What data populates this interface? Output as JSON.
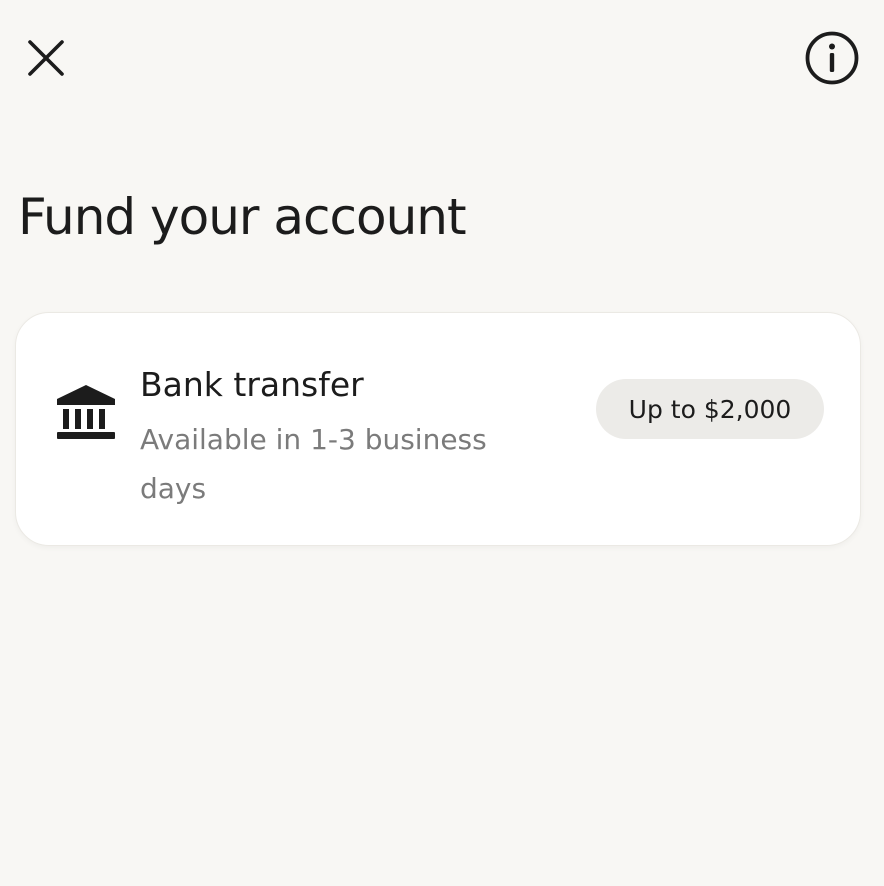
{
  "header": {
    "close_icon": "close-icon",
    "info_icon": "info-icon"
  },
  "page": {
    "title": "Fund your account"
  },
  "option": {
    "icon": "bank-icon",
    "title": "Bank transfer",
    "subtitle": "Available in 1-3 business days",
    "limit_badge": "Up to $2,000"
  },
  "colors": {
    "background": "#f8f7f4",
    "card": "#ffffff",
    "text_primary": "#1c1c1c",
    "text_secondary": "#7b7b7b",
    "badge_bg": "#ecebe8"
  }
}
